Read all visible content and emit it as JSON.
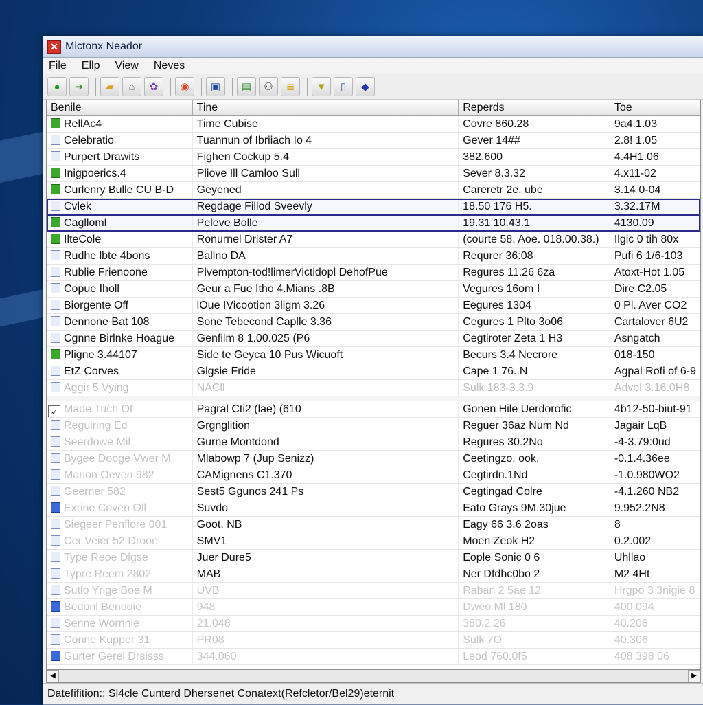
{
  "window": {
    "title": "Mictonx Neador"
  },
  "menu": [
    "File",
    "Ellp",
    "View",
    "Neves"
  ],
  "toolbar": [
    "go-icon",
    "forward-icon",
    "folder-icon",
    "home-icon",
    "settings-icon",
    "browser-icon",
    "monitor-icon",
    "image-icon",
    "user-icon",
    "notes-icon",
    "filter-icon",
    "document-icon",
    "bookmark-icon"
  ],
  "columns": [
    "Benile",
    "Tine",
    "Reperds",
    "Toe"
  ],
  "rows": [
    {
      "icon": "green",
      "name": "RellAc4",
      "time": "Time Cubise",
      "records": "Covre 860.28",
      "type": "9a4.1.03",
      "state": "normal"
    },
    {
      "icon": "plain",
      "name": "Celebratio",
      "time": "Tuannun of Ibriiach Io 4",
      "records": "Gever 14##",
      "type": "2.8! 1.05",
      "state": "normal"
    },
    {
      "icon": "plain",
      "name": "Purpert Drawits",
      "time": "Fighen Cockup 5.4",
      "records": "382.600",
      "type": "4.4H1.06",
      "state": "normal"
    },
    {
      "icon": "green",
      "name": "Inigpoerics.4",
      "time": "Pliove Ill Camloo Sull",
      "records": "Sever 8.3.32",
      "type": "4.x11-02",
      "state": "normal"
    },
    {
      "icon": "green",
      "name": "Curlenry Bulle CU B-D",
      "time": "Geyened",
      "records": "Careretr 2e, ube",
      "type": "3.14 0-04",
      "state": "normal"
    },
    {
      "icon": "plain",
      "name": "Cvlek",
      "time": "Regdage Fillod Sveevly",
      "records": "18.50 176 H5.",
      "type": "3.32.17M",
      "state": "selected"
    },
    {
      "icon": "green",
      "name": "Caglloml",
      "time": "Peleve Bolle",
      "records": "19.31 10.43.1",
      "type": "4130.09",
      "state": "selected"
    },
    {
      "icon": "green",
      "name": "IlteCole",
      "time": "Ronurnel Drister A7",
      "records": "(courte 58. Aoe. 018.00.38.)",
      "type": "Ilgic 0 tih 80x",
      "state": "normal"
    },
    {
      "icon": "plain",
      "name": "Rudhe lbte 4bons",
      "time": "Ballno DA",
      "records": "Requrer 36:08",
      "type": "Pufi 6 1/6-103",
      "state": "normal"
    },
    {
      "icon": "plain",
      "name": "Rublie Frienoone",
      "time": "Plvempton-tod!limerVictidopl DehofPue",
      "records": "Regures 11.26 6za",
      "type": "Atoxt-Hot 1.05",
      "state": "normal"
    },
    {
      "icon": "plain",
      "name": "Copue Iholl",
      "time": "Geur a Fue Itho 4.Mians .8B",
      "records": "Vegures 16om I",
      "type": "Dire C2.05",
      "state": "normal"
    },
    {
      "icon": "plain",
      "name": "Biorgente Off",
      "time": "lOue IVicootion 3ligm 3.26",
      "records": "Eegures 1304",
      "type": "0 Pl. Aver CO2",
      "state": "normal"
    },
    {
      "icon": "plain",
      "name": "Dennone Bat 108",
      "time": "Sone Tebecond Caplle 3.36",
      "records": "Cegures 1 Plto 3o06",
      "type": "Cartalover 6U2",
      "state": "normal"
    },
    {
      "icon": "plain",
      "name": "Cgnne Birlnke Hoague",
      "time": "Genfilm 8 1.00.025 (P6",
      "records": "Cegtiroter Zeta 1 H3",
      "type": "Asngatch",
      "state": "normal"
    },
    {
      "icon": "green",
      "name": "Pligne 3.44107",
      "time": "Side te Geyca 10 Pus Wicuoft",
      "records": "Becurs 3.4 Necrore",
      "type": "018-150",
      "state": "normal"
    },
    {
      "icon": "plain",
      "name": "EtZ Corves",
      "time": "Glgsie Fride",
      "records": "Cape 1 76..N",
      "type": "Agpal Rofi of 6-9",
      "state": "normal"
    },
    {
      "icon": "plain",
      "name": "Aggir 5 Vying",
      "time": "NACll",
      "records": "Sulk 183-3.3.9",
      "type": "Advel 3.16.0H8",
      "state": "half"
    }
  ],
  "section": {
    "name": "Made Tuch Of",
    "time": "Pagral Cti2 (lae) (610",
    "records": "Gonen Hile Uerdorofic",
    "type": "4b12-50-biut-91"
  },
  "rows2": [
    {
      "icon": "plain",
      "name": "Reguiring Ed",
      "time": "Grgnglition",
      "records": "Reguer 36az Num Nd",
      "type": "Jagair LqB"
    },
    {
      "icon": "plain",
      "name": "Seerdowe Mil",
      "time": "Gurne Montdond",
      "records": "Regures 30.2No",
      "type": "-4-3.79:0ud"
    },
    {
      "icon": "plain",
      "name": "Bygee Dooge Vwer M",
      "time": "Mlabowp 7 (Jup Senizz)",
      "records": "Ceetingzo. ook.",
      "type": "-0.1.4.36ee"
    },
    {
      "icon": "plain",
      "name": "Marion Oeven 982",
      "time": "CAMignens C1.370",
      "records": "Cegtirdn.1Nd",
      "type": "-1.0.980WO2"
    },
    {
      "icon": "plain",
      "name": "Geerner 582",
      "time": "Sest5 Ggunos 241 Ps",
      "records": "Cegtingad Colre",
      "type": "-4.1.260 NB2"
    },
    {
      "icon": "blue",
      "name": "Exrine Coven Oll",
      "time": "Suvdo",
      "records": "Eato Grays 9M.30jue",
      "type": "9.952.2N8"
    },
    {
      "icon": "plain",
      "name": "Siegeer Penflore 001",
      "time": "Goot. NB",
      "records": "Eagy 66 3.6 2oas",
      "type": "8"
    },
    {
      "icon": "plain",
      "name": "Cer Veier 52 Drooe",
      "time": "SMV1",
      "records": "Moen Zeok H2",
      "type": "0.2.002"
    },
    {
      "icon": "plain",
      "name": "Type Reoe Dlgse",
      "time": "Juer Dure5",
      "records": "Eople Sonic 0 6",
      "type": "Uhllao"
    },
    {
      "icon": "plain",
      "name": "Typre Reem 2802",
      "time": "MAB",
      "records": "Ner Dfdhc0bo 2",
      "type": "M2 4Ht"
    },
    {
      "icon": "plain",
      "name": "Sutlo Yrige Boe M",
      "time": "UVB",
      "records": "Raban 2 5ae 12",
      "type": "Hrgpo 3 3nigie 8"
    },
    {
      "icon": "blue",
      "name": "Bedonl Benooie",
      "time": "948",
      "records": "Dweo Ml 180",
      "type": "400.094"
    },
    {
      "icon": "plain",
      "name": "Senne Wornnle",
      "time": "21.048",
      "records": "380.2.26",
      "type": "40.206"
    },
    {
      "icon": "plain",
      "name": "Conne Kupper 31",
      "time": "PR08",
      "records": "Sulk 7O",
      "type": "40.306"
    },
    {
      "icon": "blue",
      "name": "Gurter Gerel Drsisss",
      "time": "344.060",
      "records": "Leod 760.0f5",
      "type": "408 398 06"
    }
  ],
  "status": "Datefifition:: Sl4cle Cunterd Dhersenet Conatext(Refcletor/Bel29)eternit"
}
